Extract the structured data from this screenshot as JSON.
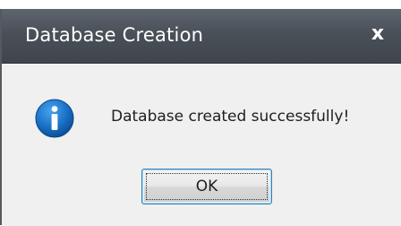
{
  "dialog": {
    "title": "Database Creation",
    "close_label": "x",
    "icon": "info-icon",
    "message": "Database created successfully!",
    "ok_label": "OK"
  },
  "colors": {
    "titlebar": "#4a5058",
    "title_text": "#ffffff",
    "body_background": "#f0f0f0",
    "info_icon": "#1a73c9",
    "button_border": "#3c7fb1"
  }
}
